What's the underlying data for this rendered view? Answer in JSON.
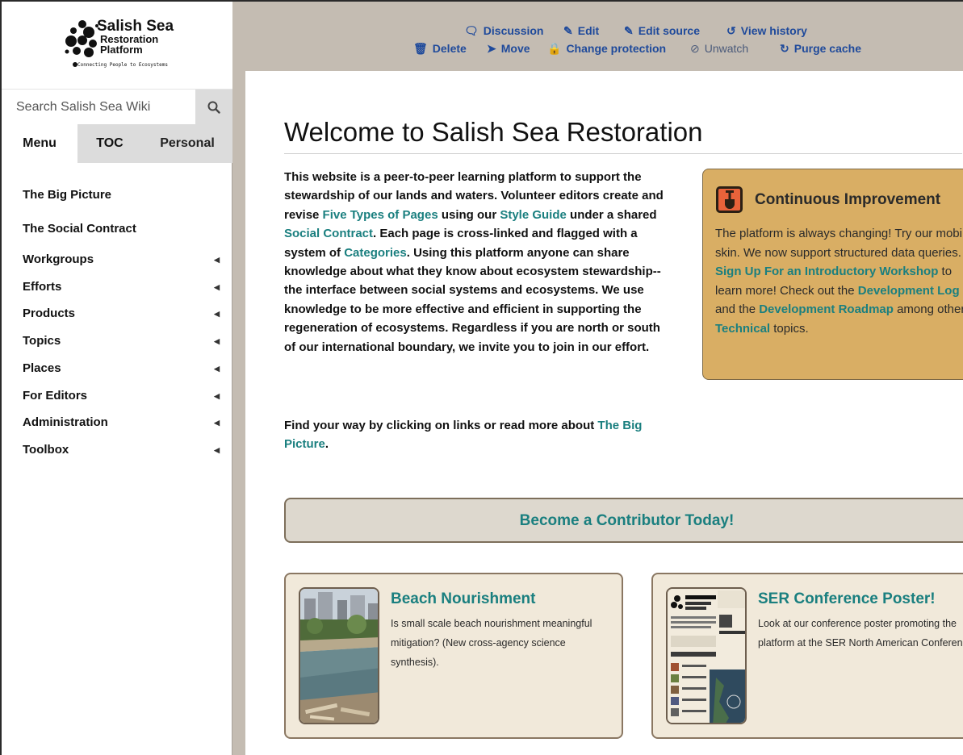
{
  "logo": {
    "title": "Salish Sea",
    "line2": "Restoration",
    "line3": "Platform",
    "tagline": "Connecting People to Ecosystems"
  },
  "search": {
    "placeholder": "Search Salish Sea Wiki"
  },
  "tabs": [
    {
      "label": "Menu"
    },
    {
      "label": "TOC"
    },
    {
      "label": "Personal"
    }
  ],
  "nav": {
    "links": [
      "The Big Picture",
      "The Social Contract"
    ],
    "groups": [
      "Workgroups",
      "Efforts",
      "Products",
      "Topics",
      "Places",
      "For Editors",
      "Administration",
      "Toolbox"
    ]
  },
  "actions": {
    "row1": [
      {
        "label": "Discussion",
        "icon": "discussion-icon"
      },
      {
        "label": "Edit",
        "icon": "edit-icon"
      },
      {
        "label": "Edit source",
        "icon": "edit-source-icon"
      },
      {
        "label": "View history",
        "icon": "history-icon"
      }
    ],
    "row2": [
      {
        "label": "Delete",
        "icon": "trash-icon"
      },
      {
        "label": "Move",
        "icon": "move-icon"
      },
      {
        "label": "Change protection",
        "icon": "lock-icon"
      },
      {
        "label": "Unwatch",
        "icon": "eye-slash-icon"
      },
      {
        "label": "Purge cache",
        "icon": "refresh-icon"
      }
    ]
  },
  "page": {
    "title": "Welcome to Salish Sea Restoration",
    "intro": {
      "p1": "This website is a peer-to-peer learning platform to support the stewardship of our lands and waters. Volunteer editors create and revise ",
      "link1": "Five Types of Pages",
      "p2": " using our ",
      "link2": "Style Guide",
      "p3": " under a shared ",
      "link3": "Social Contract",
      "p4": ". Each page is cross-linked and flagged with a system of ",
      "link4": "Categories",
      "p5": ". Using this platform anyone can share knowledge about what they know about ecosystem stewardship--the interface between social systems and ecosystems. We use knowledge to be more effective and efficient in supporting the regeneration of ecosystems. Regardless if you are north or south of our international boundary, we invite you to join in our effort."
    },
    "find": {
      "text": "Find your way by clicking on links or read more about ",
      "link": "The Big Picture",
      "end": "."
    },
    "improvement": {
      "title": "Continuous Improvement",
      "t1": "The platform is always changing! Try our mobile skin. We now support structured data queries. ",
      "l1": "Sign Up For an Introductory Workshop",
      "t2": " to learn more! Check out the ",
      "l2": "Development Log",
      "t3": " and the ",
      "l3": "Development Roadmap",
      "t4": " among other ",
      "l4": "Technical",
      "t5": " topics."
    },
    "contributor": "Become a Contributor Today!",
    "cards": [
      {
        "title": "Beach Nourishment",
        "text": "Is small scale beach nourishment meaningful mitigation? (New cross-agency science synthesis)."
      },
      {
        "title": "SER Conference Poster!",
        "text": "Look at our conference poster promoting the platform at the SER North American Conference."
      }
    ]
  },
  "colors": {
    "chrome": "#c4bcb2",
    "link": "#1a7f7f",
    "action_link": "#1f4a9b",
    "improvement_bg": "#d9ae64",
    "card_bg": "#f1e9da"
  }
}
